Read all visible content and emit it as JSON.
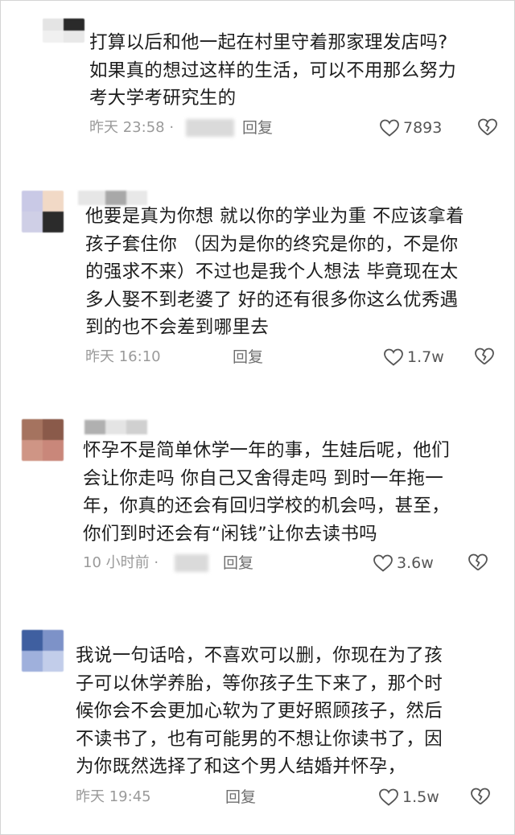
{
  "comments": [
    {
      "text": "打算以后和他一起在村里守着那家理发店吗?\n如果真的想过这样的生活，可以不用那么努力\n考大学考研究生的",
      "time": "昨天 23:58 ·",
      "reply": "回复",
      "likes": "7893"
    },
    {
      "text": "他要是真为你想 就以你的学业为重 不应该拿着\n孩子套住你 （因为是你的终究是你的，不是你\n的强求不来）不过也是我个人想法 毕竟现在太\n多人娶不到老婆了 好的还有很多你这么优秀遇\n到的也不会差到哪里去",
      "time": "昨天 16:10",
      "reply": "回复",
      "likes": "1.7w"
    },
    {
      "text": "怀孕不是简单休学一年的事，生娃后呢，他们\n会让你走吗 你自己又舍得走吗 到时一年拖一\n年，你真的还会有回归学校的机会吗，甚至，\n你们到时还会有“闲钱”让你去读书吗",
      "time": "10 小时前 ·",
      "reply": "回复",
      "likes": "3.6w"
    },
    {
      "text": "我说一句话哈，不喜欢可以删，你现在为了孩\n子可以休学养胎，等你孩子生下来了，那个时\n候你会不会更加心软为了更好照顾孩子，然后\n不读书了，也有可能男的不想让你读书了，因\n为你既然选择了和这个男人结婚并怀孕，",
      "time": "昨天 19:45",
      "reply": "回复",
      "likes": "1.5w"
    }
  ],
  "colors": {
    "text": "#1d1d1d",
    "meta": "#9a9a9a",
    "reply": "#6f6f6f",
    "icon": "#555555"
  },
  "icons": {
    "like": "heart-outline-icon",
    "dislike": "broken-heart-icon"
  }
}
